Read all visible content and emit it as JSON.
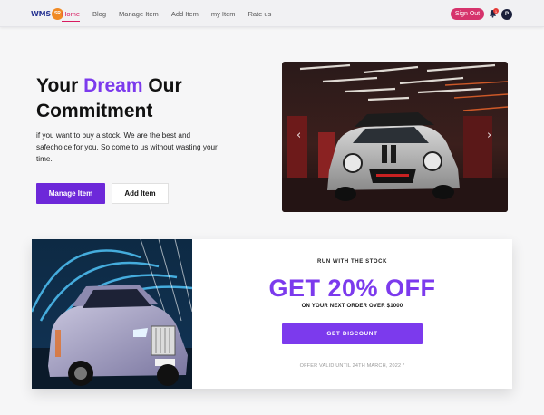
{
  "nav": {
    "logo_text": "WMS",
    "logo_badge": "SR",
    "links": [
      "Home",
      "Blog",
      "Manage Item",
      "Add Item",
      "my Item",
      "Rate us"
    ],
    "active_index": 0,
    "signout_label": "Sign Out",
    "notification_count": "1",
    "avatar_initial": "P"
  },
  "hero": {
    "title_part1": "Your ",
    "title_accent": "Dream",
    "title_part2": " Our",
    "title_line2": "Commitment",
    "description": "if you want to buy a stock. We are the best and safechoice for you. So come to us without wasting your time.",
    "primary_button": "Manage Item",
    "secondary_button": "Add Item",
    "carousel_prev_icon": "chevron-left-icon",
    "carousel_next_icon": "chevron-right-icon"
  },
  "promo": {
    "eyebrow": "RUN WITH THE STOCK",
    "headline": "GET 20% OFF",
    "subline": "ON YOUR NEXT ORDER OVER $1000",
    "button": "GET DISCOUNT",
    "validity": "OFFER VALID UNTIL 24TH MARCH, 2022 *"
  },
  "colors": {
    "accent": "#7c3aed",
    "primary_button": "#6d28d9",
    "active_link": "#d81b60",
    "signout": "#d6336c"
  }
}
